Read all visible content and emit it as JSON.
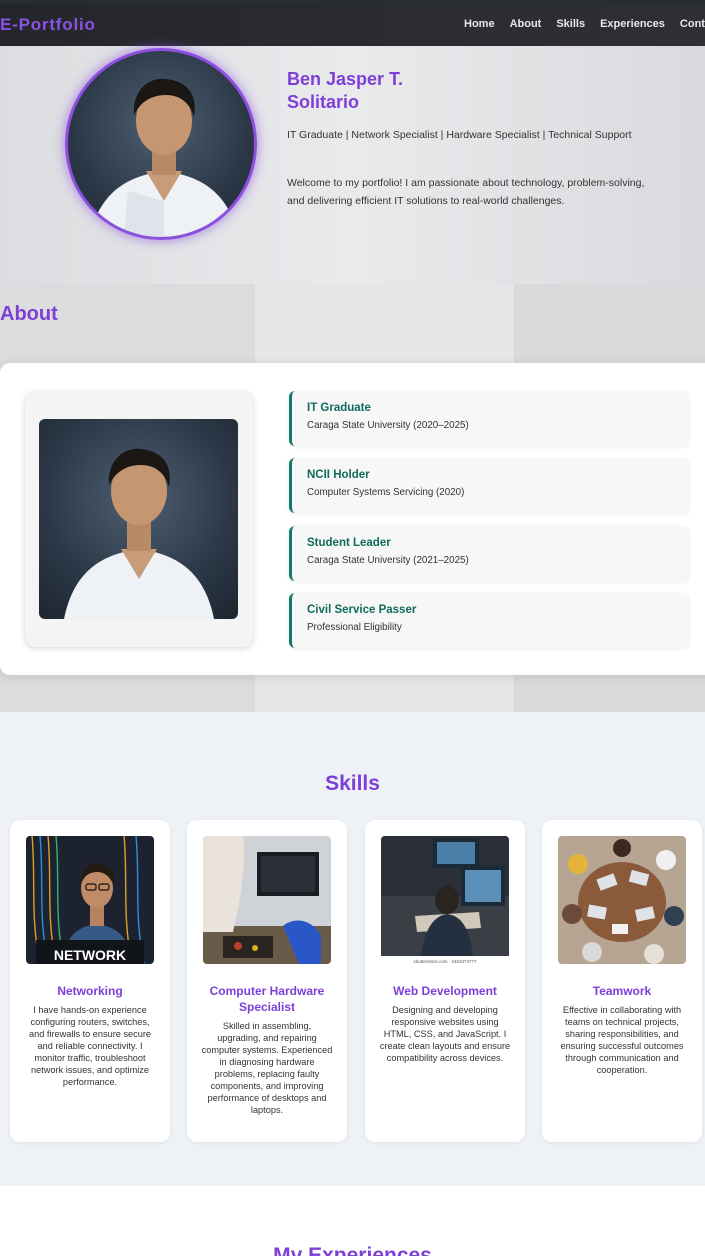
{
  "nav": {
    "brand": "E-Portfolio",
    "links": [
      "Home",
      "About",
      "Skills",
      "Experiences",
      "Conta"
    ]
  },
  "hero": {
    "name_line1": "Ben Jasper T.",
    "name_line2": "Solitario",
    "subtitle": "IT Graduate | Network Specialist | Hardware Specialist | Technical Support",
    "welcome": "Welcome to my portfolio! I am passionate about technology, problem-solving, and delivering efficient IT solutions to real-world challenges."
  },
  "about": {
    "title": "About",
    "credentials": [
      {
        "title": "IT Graduate",
        "desc": "Caraga State University (2020–2025)"
      },
      {
        "title": "NCII Holder",
        "desc": "Computer Systems Servicing (2020)"
      },
      {
        "title": "Student Leader",
        "desc": "Caraga State University (2021–2025)"
      },
      {
        "title": "Civil Service Passer",
        "desc": "Professional Eligibility"
      }
    ]
  },
  "skills": {
    "title": "Skills",
    "items": [
      {
        "name": "Networking",
        "image_caption": "NETWORK",
        "desc": "I have hands-on experience configuring routers, switches, and firewalls to ensure secure and reliable connectivity. I monitor traffic, troubleshoot network issues, and optimize performance."
      },
      {
        "name": "Computer Hardware Specialist",
        "desc": "Skilled in assembling, upgrading, and repairing computer systems. Experienced in diagnosing hardware problems, replacing faulty components, and improving performance of desktops and laptops."
      },
      {
        "name": "Web Development",
        "image_caption": "shutterstock.com · 2463474777",
        "desc": "Designing and developing responsive websites using HTML, CSS, and JavaScript. I create clean layouts and ensure compatibility across devices."
      },
      {
        "name": "Teamwork",
        "desc": "Effective in collaborating with teams on technical projects, sharing responsibilities, and ensuring successful outcomes through communication and cooperation."
      }
    ]
  },
  "experiences": {
    "title": "My Experiences"
  }
}
